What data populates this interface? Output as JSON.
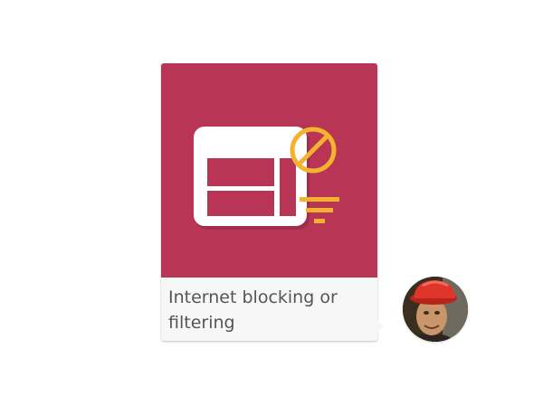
{
  "message": {
    "caption": "Internet blocking or filtering",
    "illustration_icon": "blocked-filtered-window-icon",
    "background_color": "#b93556",
    "accent_color": "#f4b32f",
    "caption_background_color": "#f7f7f7",
    "caption_text_color": "#555555"
  },
  "sender": {
    "avatar_icon": "person-with-red-hat-avatar"
  }
}
